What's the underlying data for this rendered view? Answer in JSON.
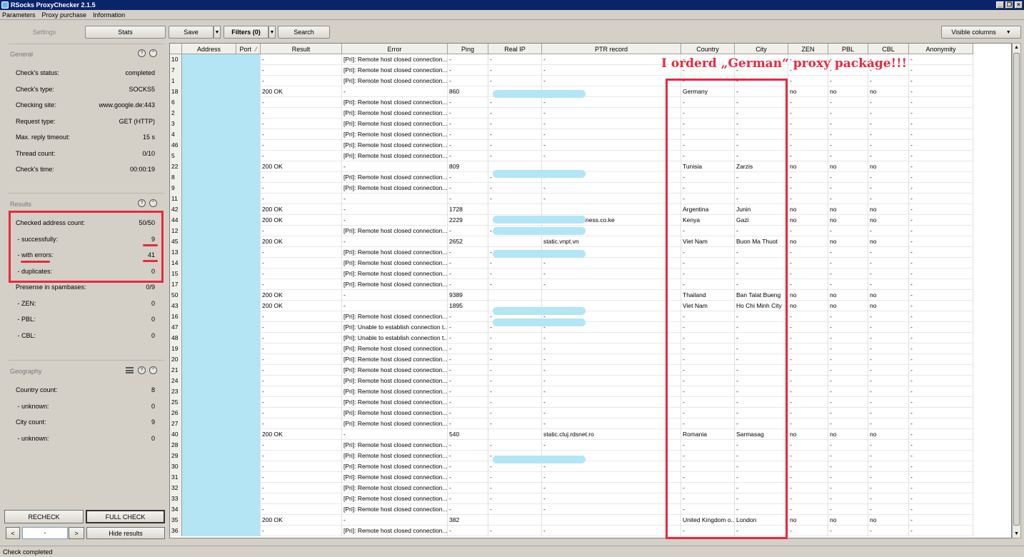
{
  "window": {
    "title": "RSocks ProxyChecker 2.1.5"
  },
  "menu": [
    "Parameters",
    "Proxy purchase",
    "Information"
  ],
  "toolbar": {
    "settings_tab": "Settings",
    "stats_tab": "Stats",
    "save": "Save",
    "filters": "Filters (0)",
    "search": "Search",
    "visible_columns": "Visible columns"
  },
  "general": {
    "heading": "General",
    "rows": [
      {
        "label": "Check's status:",
        "value": "completed"
      },
      {
        "label": "Check's type:",
        "value": "SOCKS5"
      },
      {
        "label": "Checking site:",
        "value": "www.google.de:443"
      },
      {
        "label": "Request type:",
        "value": "GET (HTTP)"
      },
      {
        "label": "Max. reply timeout:",
        "value": "15 s"
      },
      {
        "label": "Thread count:",
        "value": "0/10"
      },
      {
        "label": "Check's time:",
        "value": "00:00:19"
      }
    ]
  },
  "results": {
    "heading": "Results",
    "rows": [
      {
        "label": "Checked address count:",
        "value": "50/50"
      },
      {
        "label": " - successfully:",
        "value": "9"
      },
      {
        "label": " - with errors:",
        "value": "41"
      },
      {
        "label": " - duplicates:",
        "value": "0"
      },
      {
        "label": "Presense in spambases:",
        "value": "0/9"
      },
      {
        "label": " - ZEN:",
        "value": "0"
      },
      {
        "label": " - PBL:",
        "value": "0"
      },
      {
        "label": " - CBL:",
        "value": "0"
      }
    ]
  },
  "geography": {
    "heading": "Geography",
    "rows": [
      {
        "label": "Country count:",
        "value": "8"
      },
      {
        "label": " - unknown:",
        "value": "0"
      },
      {
        "label": "City count:",
        "value": "9"
      },
      {
        "label": " - unknown:",
        "value": "0"
      }
    ]
  },
  "buttons": {
    "recheck": "RECHECK",
    "full_check": "FULL CHECK",
    "prev": "<",
    "next": ">",
    "page": "-",
    "hide_results": "Hide results"
  },
  "status": "Check completed",
  "annotation": "I orderd „German“ proxy package!!!",
  "columns": [
    "Address",
    "Port",
    "Result",
    "Error",
    "Ping",
    "Real IP",
    "PTR record",
    "Country",
    "City",
    "ZEN",
    "PBL",
    "CBL",
    "Anonymity"
  ],
  "port_sort_indicator": "⁄",
  "rows": [
    {
      "n": "10",
      "result": "-",
      "error": "[Pri]: Remote host closed connection...",
      "ping": "-",
      "realip": "-",
      "ptr": "-",
      "country": "-",
      "city": "-",
      "zen": "-",
      "pbl": "-",
      "cbl": "-",
      "anon": "-"
    },
    {
      "n": "7",
      "result": "-",
      "error": "[Pri]: Remote host closed connection...",
      "ping": "-",
      "realip": "-",
      "ptr": "-",
      "country": "-",
      "city": "-",
      "zen": "-",
      "pbl": "-",
      "cbl": "-",
      "anon": "-"
    },
    {
      "n": "1",
      "result": "-",
      "error": "[Pri]: Remote host closed connection...",
      "ping": "-",
      "realip": "-",
      "ptr": "-",
      "country": "-",
      "city": "-",
      "zen": "-",
      "pbl": "-",
      "cbl": "-",
      "anon": "-"
    },
    {
      "n": "18",
      "result": "200 OK",
      "error": "-",
      "ping": "860",
      "realip": "",
      "ptr": "",
      "country": "Germany",
      "city": "-",
      "zen": "no",
      "pbl": "no",
      "cbl": "no",
      "anon": "-",
      "blur": true
    },
    {
      "n": "6",
      "result": "-",
      "error": "[Pri]: Remote host closed connection...",
      "ping": "-",
      "realip": "-",
      "ptr": "-",
      "country": "-",
      "city": "-",
      "zen": "-",
      "pbl": "-",
      "cbl": "-",
      "anon": "-"
    },
    {
      "n": "2",
      "result": "-",
      "error": "[Pri]: Remote host closed connection...",
      "ping": "-",
      "realip": "-",
      "ptr": "-",
      "country": "-",
      "city": "-",
      "zen": "-",
      "pbl": "-",
      "cbl": "-",
      "anon": "-"
    },
    {
      "n": "3",
      "result": "-",
      "error": "[Pri]: Remote host closed connection...",
      "ping": "-",
      "realip": "-",
      "ptr": "-",
      "country": "-",
      "city": "-",
      "zen": "-",
      "pbl": "-",
      "cbl": "-",
      "anon": "-"
    },
    {
      "n": "4",
      "result": "-",
      "error": "[Pri]: Remote host closed connection...",
      "ping": "-",
      "realip": "-",
      "ptr": "-",
      "country": "-",
      "city": "-",
      "zen": "-",
      "pbl": "-",
      "cbl": "-",
      "anon": "-"
    },
    {
      "n": "46",
      "result": "-",
      "error": "[Pri]: Remote host closed connection...",
      "ping": "-",
      "realip": "-",
      "ptr": "-",
      "country": "-",
      "city": "-",
      "zen": "-",
      "pbl": "-",
      "cbl": "-",
      "anon": "-"
    },
    {
      "n": "5",
      "result": "-",
      "error": "[Pri]: Remote host closed connection...",
      "ping": "-",
      "realip": "-",
      "ptr": "-",
      "country": "-",
      "city": "-",
      "zen": "-",
      "pbl": "-",
      "cbl": "-",
      "anon": "-"
    },
    {
      "n": "22",
      "result": "200 OK",
      "error": "-",
      "ping": "809",
      "realip": "",
      "ptr": "",
      "country": "Tunisia",
      "city": "Zarzis",
      "zen": "no",
      "pbl": "no",
      "cbl": "no",
      "anon": "-",
      "blur": true
    },
    {
      "n": "8",
      "result": "-",
      "error": "[Pri]: Remote host closed connection...",
      "ping": "-",
      "realip": "-",
      "ptr": "-",
      "country": "-",
      "city": "-",
      "zen": "-",
      "pbl": "-",
      "cbl": "-",
      "anon": "-"
    },
    {
      "n": "9",
      "result": "-",
      "error": "[Pri]: Remote host closed connection...",
      "ping": "-",
      "realip": "-",
      "ptr": "-",
      "country": "-",
      "city": "-",
      "zen": "-",
      "pbl": "-",
      "cbl": "-",
      "anon": "-"
    },
    {
      "n": "11",
      "result": "-",
      "error": "-",
      "ping": "-",
      "realip": "-",
      "ptr": "-",
      "country": "-",
      "city": "-",
      "zen": "-",
      "pbl": "-",
      "cbl": "-",
      "anon": "-"
    },
    {
      "n": "42",
      "result": "200 OK",
      "error": "-",
      "ping": "1728",
      "realip": "",
      "ptr": "",
      "country": "Argentina",
      "city": "Junin",
      "zen": "no",
      "pbl": "no",
      "cbl": "no",
      "anon": "-",
      "blur": true
    },
    {
      "n": "44",
      "result": "200 OK",
      "error": "-",
      "ping": "2229",
      "realip": "",
      "ptr": "s.safaricombusiness.co.ke",
      "country": "Kenya",
      "city": "Gazi",
      "zen": "no",
      "pbl": "no",
      "cbl": "no",
      "anon": "-",
      "blur": true
    },
    {
      "n": "12",
      "result": "-",
      "error": "[Pri]: Remote host closed connection...",
      "ping": "-",
      "realip": "-",
      "ptr": "-",
      "country": "-",
      "city": "-",
      "zen": "-",
      "pbl": "-",
      "cbl": "-",
      "anon": "-"
    },
    {
      "n": "45",
      "result": "200 OK",
      "error": "-",
      "ping": "2652",
      "realip": "",
      "ptr": "static.vnpt.vn",
      "country": "Viet Nam",
      "city": "Buon Ma Thuot",
      "zen": "no",
      "pbl": "no",
      "cbl": "no",
      "anon": "-",
      "blur": true
    },
    {
      "n": "13",
      "result": "-",
      "error": "[Pri]: Remote host closed connection...",
      "ping": "-",
      "realip": "-",
      "ptr": "-",
      "country": "-",
      "city": "-",
      "zen": "-",
      "pbl": "-",
      "cbl": "-",
      "anon": "-"
    },
    {
      "n": "14",
      "result": "-",
      "error": "[Pri]: Remote host closed connection...",
      "ping": "-",
      "realip": "-",
      "ptr": "-",
      "country": "-",
      "city": "-",
      "zen": "-",
      "pbl": "-",
      "cbl": "-",
      "anon": "-"
    },
    {
      "n": "15",
      "result": "-",
      "error": "[Pri]: Remote host closed connection...",
      "ping": "-",
      "realip": "-",
      "ptr": "-",
      "country": "-",
      "city": "-",
      "zen": "-",
      "pbl": "-",
      "cbl": "-",
      "anon": "-"
    },
    {
      "n": "17",
      "result": "-",
      "error": "[Pri]: Remote host closed connection...",
      "ping": "-",
      "realip": "-",
      "ptr": "-",
      "country": "-",
      "city": "-",
      "zen": "-",
      "pbl": "-",
      "cbl": "-",
      "anon": "-"
    },
    {
      "n": "50",
      "result": "200 OK",
      "error": "-",
      "ping": "9389",
      "realip": "",
      "ptr": "",
      "country": "Thailand",
      "city": "Ban Talat Bueng",
      "zen": "no",
      "pbl": "no",
      "cbl": "no",
      "anon": "-",
      "blur": true
    },
    {
      "n": "43",
      "result": "200 OK",
      "error": "-",
      "ping": "1895",
      "realip": "",
      "ptr": "",
      "country": "Viet Nam",
      "city": "Ho Chi Minh City",
      "zen": "no",
      "pbl": "no",
      "cbl": "no",
      "anon": "-",
      "blur": true
    },
    {
      "n": "16",
      "result": "-",
      "error": "[Pri]: Remote host closed connection...",
      "ping": "-",
      "realip": "-",
      "ptr": "-",
      "country": "-",
      "city": "-",
      "zen": "-",
      "pbl": "-",
      "cbl": "-",
      "anon": "-"
    },
    {
      "n": "47",
      "result": "-",
      "error": "[Pri]: Unable to establish connection t...",
      "ping": "-",
      "realip": "-",
      "ptr": "-",
      "country": "-",
      "city": "-",
      "zen": "-",
      "pbl": "-",
      "cbl": "-",
      "anon": "-"
    },
    {
      "n": "48",
      "result": "-",
      "error": "[Pri]: Unable to establish connection t...",
      "ping": "-",
      "realip": "-",
      "ptr": "-",
      "country": "-",
      "city": "-",
      "zen": "-",
      "pbl": "-",
      "cbl": "-",
      "anon": "-"
    },
    {
      "n": "19",
      "result": "-",
      "error": "[Pri]: Remote host closed connection...",
      "ping": "-",
      "realip": "-",
      "ptr": "-",
      "country": "-",
      "city": "-",
      "zen": "-",
      "pbl": "-",
      "cbl": "-",
      "anon": "-"
    },
    {
      "n": "20",
      "result": "-",
      "error": "[Pri]: Remote host closed connection...",
      "ping": "-",
      "realip": "-",
      "ptr": "-",
      "country": "-",
      "city": "-",
      "zen": "-",
      "pbl": "-",
      "cbl": "-",
      "anon": "-"
    },
    {
      "n": "21",
      "result": "-",
      "error": "[Pri]: Remote host closed connection...",
      "ping": "-",
      "realip": "-",
      "ptr": "-",
      "country": "-",
      "city": "-",
      "zen": "-",
      "pbl": "-",
      "cbl": "-",
      "anon": "-"
    },
    {
      "n": "24",
      "result": "-",
      "error": "[Pri]: Remote host closed connection...",
      "ping": "-",
      "realip": "-",
      "ptr": "-",
      "country": "-",
      "city": "-",
      "zen": "-",
      "pbl": "-",
      "cbl": "-",
      "anon": "-"
    },
    {
      "n": "23",
      "result": "-",
      "error": "[Pri]: Remote host closed connection...",
      "ping": "-",
      "realip": "-",
      "ptr": "-",
      "country": "-",
      "city": "-",
      "zen": "-",
      "pbl": "-",
      "cbl": "-",
      "anon": "-"
    },
    {
      "n": "25",
      "result": "-",
      "error": "[Pri]: Remote host closed connection...",
      "ping": "-",
      "realip": "-",
      "ptr": "-",
      "country": "-",
      "city": "-",
      "zen": "-",
      "pbl": "-",
      "cbl": "-",
      "anon": "-"
    },
    {
      "n": "26",
      "result": "-",
      "error": "[Pri]: Remote host closed connection...",
      "ping": "-",
      "realip": "-",
      "ptr": "-",
      "country": "-",
      "city": "-",
      "zen": "-",
      "pbl": "-",
      "cbl": "-",
      "anon": "-"
    },
    {
      "n": "27",
      "result": "-",
      "error": "[Pri]: Remote host closed connection...",
      "ping": "-",
      "realip": "-",
      "ptr": "-",
      "country": "-",
      "city": "-",
      "zen": "-",
      "pbl": "-",
      "cbl": "-",
      "anon": "-"
    },
    {
      "n": "40",
      "result": "200 OK",
      "error": "-",
      "ping": "540",
      "realip": "",
      "ptr": "static.cluj.rdsnet.ro",
      "country": "Romania",
      "city": "Sarmasag",
      "zen": "no",
      "pbl": "no",
      "cbl": "no",
      "anon": "-",
      "blur": true
    },
    {
      "n": "28",
      "result": "-",
      "error": "[Pri]: Remote host closed connection...",
      "ping": "-",
      "realip": "-",
      "ptr": "-",
      "country": "-",
      "city": "-",
      "zen": "-",
      "pbl": "-",
      "cbl": "-",
      "anon": "-"
    },
    {
      "n": "29",
      "result": "-",
      "error": "[Pri]: Remote host closed connection...",
      "ping": "-",
      "realip": "-",
      "ptr": "-",
      "country": "-",
      "city": "-",
      "zen": "-",
      "pbl": "-",
      "cbl": "-",
      "anon": "-"
    },
    {
      "n": "30",
      "result": "-",
      "error": "[Pri]: Remote host closed connection...",
      "ping": "-",
      "realip": "-",
      "ptr": "-",
      "country": "-",
      "city": "-",
      "zen": "-",
      "pbl": "-",
      "cbl": "-",
      "anon": "-"
    },
    {
      "n": "31",
      "result": "-",
      "error": "[Pri]: Remote host closed connection...",
      "ping": "-",
      "realip": "-",
      "ptr": "-",
      "country": "-",
      "city": "-",
      "zen": "-",
      "pbl": "-",
      "cbl": "-",
      "anon": "-"
    },
    {
      "n": "32",
      "result": "-",
      "error": "[Pri]: Remote host closed connection...",
      "ping": "-",
      "realip": "-",
      "ptr": "-",
      "country": "-",
      "city": "-",
      "zen": "-",
      "pbl": "-",
      "cbl": "-",
      "anon": "-"
    },
    {
      "n": "33",
      "result": "-",
      "error": "[Pri]: Remote host closed connection...",
      "ping": "-",
      "realip": "-",
      "ptr": "-",
      "country": "-",
      "city": "-",
      "zen": "-",
      "pbl": "-",
      "cbl": "-",
      "anon": "-"
    },
    {
      "n": "34",
      "result": "-",
      "error": "[Pri]: Remote host closed connection...",
      "ping": "-",
      "realip": "-",
      "ptr": "-",
      "country": "-",
      "city": "-",
      "zen": "-",
      "pbl": "-",
      "cbl": "-",
      "anon": "-"
    },
    {
      "n": "35",
      "result": "200 OK",
      "error": "-",
      "ping": "382",
      "realip": "",
      "ptr": "",
      "country": "United Kingdom o...",
      "city": "London",
      "zen": "no",
      "pbl": "no",
      "cbl": "no",
      "anon": "-",
      "blur": true
    },
    {
      "n": "36",
      "result": "-",
      "error": "[Pri]: Remote host closed connection...",
      "ping": "-",
      "realip": "-",
      "ptr": "-",
      "country": "-",
      "city": "-",
      "zen": "-",
      "pbl": "-",
      "cbl": "-",
      "anon": "-"
    }
  ]
}
